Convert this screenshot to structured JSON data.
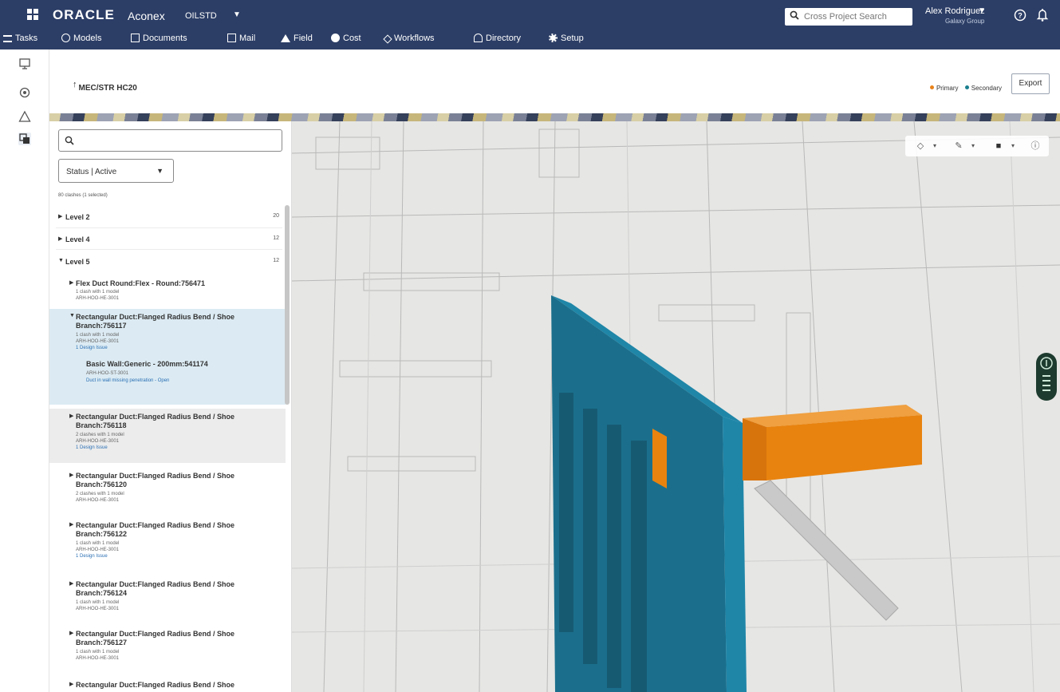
{
  "header": {
    "brand": "ORACLE",
    "brand_product": "Aconex",
    "project": "OILSTD",
    "search_placeholder": "Cross Project Search",
    "user_name": "Alex Rodriguez",
    "user_org": "Galaxy Group",
    "nav": [
      {
        "label": "Tasks",
        "icon": "tasks-icon"
      },
      {
        "label": "Models",
        "icon": "models-icon"
      },
      {
        "label": "Documents",
        "icon": "documents-icon"
      },
      {
        "label": "Mail",
        "icon": "mail-icon"
      },
      {
        "label": "Field",
        "icon": "field-icon"
      },
      {
        "label": "Cost",
        "icon": "cost-icon"
      },
      {
        "label": "Workflows",
        "icon": "workflows-icon"
      },
      {
        "label": "Directory",
        "icon": "directory-icon"
      },
      {
        "label": "Setup",
        "icon": "setup-icon"
      }
    ]
  },
  "page": {
    "title": "MEC/STR HC20",
    "legend_primary": "Primary",
    "legend_secondary": "Secondary",
    "export_label": "Export",
    "colors": {
      "primary": "#e8821a",
      "secondary": "#1a7f8e",
      "header": "#2c3e66",
      "wall": "#1b6f8c",
      "duct": "#e8830f"
    }
  },
  "panel": {
    "status_filter": "Status | Active",
    "count_text": "80 clashes (1 selected)",
    "levels": [
      {
        "label": "Level 2",
        "count": "20"
      },
      {
        "label": "Level 4",
        "count": "12"
      },
      {
        "label": "Level 5",
        "count": "12"
      }
    ],
    "items": [
      {
        "title": "Flex Duct Round:Flex - Round:756471",
        "sub1": "1 clash with 1 model",
        "sub2": "ARH-HOO-HE-3001",
        "issue": ""
      },
      {
        "title": "Rectangular Duct:Flanged Radius Bend / Shoe Branch:756117",
        "sub1": "1 clash with 1 model",
        "sub2": "ARH-HOO-HE-3001",
        "issue": "1 Design Issue"
      },
      {
        "title": "Rectangular Duct:Flanged Radius Bend / Shoe Branch:756118",
        "sub1": "2 clashes with 1 model",
        "sub2": "ARH-HOO-HE-3001",
        "issue": "1 Design Issue"
      },
      {
        "title": "Rectangular Duct:Flanged Radius Bend / Shoe Branch:756120",
        "sub1": "2 clashes with 1 model",
        "sub2": "ARH-HOO-HE-3001",
        "issue": ""
      },
      {
        "title": "Rectangular Duct:Flanged Radius Bend / Shoe Branch:756122",
        "sub1": "1 clash with 1 model",
        "sub2": "ARH-HOO-HE-3001",
        "issue": "1 Design Issue"
      },
      {
        "title": "Rectangular Duct:Flanged Radius Bend / Shoe Branch:756124",
        "sub1": "1 clash with 1 model",
        "sub2": "ARH-HOO-HE-3001",
        "issue": ""
      },
      {
        "title": "Rectangular Duct:Flanged Radius Bend / Shoe Branch:756127",
        "sub1": "1 clash with 1 model",
        "sub2": "ARH-HOO-HE-3001",
        "issue": ""
      },
      {
        "title": "Rectangular Duct:Flanged Radius Bend / Shoe",
        "sub1": "",
        "sub2": "",
        "issue": ""
      }
    ],
    "subitem": {
      "title": "Basic Wall:Generic - 200mm:541174",
      "sub": "ARH-HOO-ST-3001",
      "issue": "Duct in wall missing penetration - Open"
    }
  }
}
